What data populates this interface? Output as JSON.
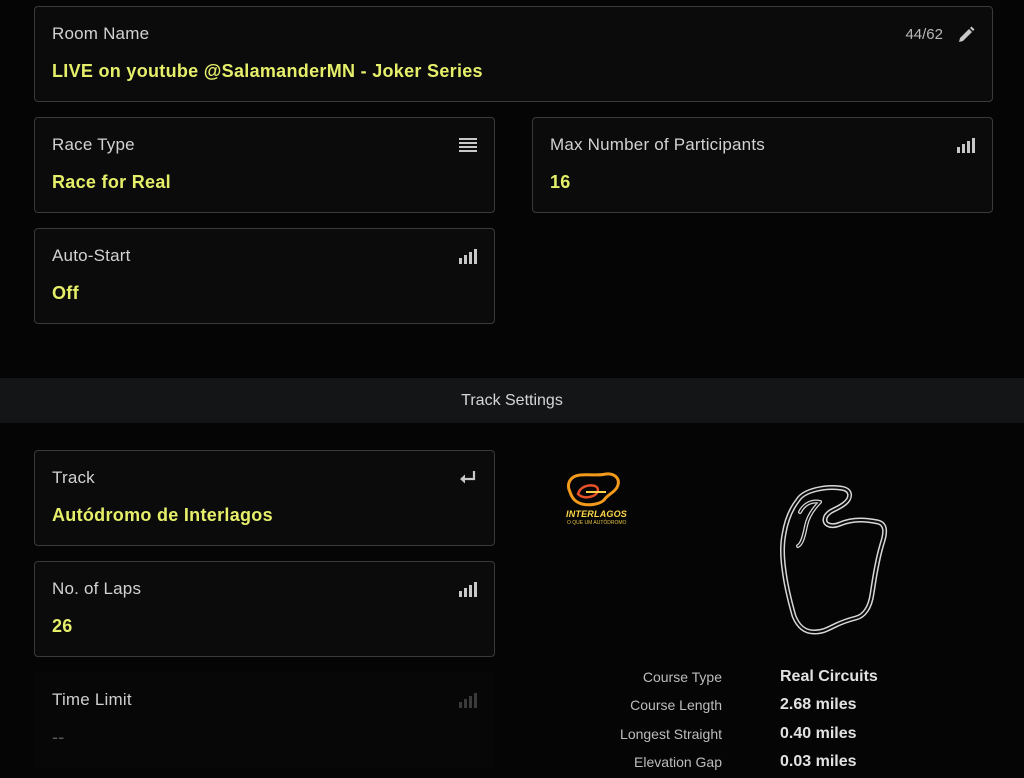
{
  "room": {
    "label": "Room Name",
    "value": "LIVE on youtube @SalamanderMN - Joker Series",
    "counter": "44/62"
  },
  "race_type": {
    "label": "Race Type",
    "value": "Race for Real"
  },
  "max_participants": {
    "label": "Max Number of Participants",
    "value": "16"
  },
  "auto_start": {
    "label": "Auto-Start",
    "value": "Off"
  },
  "section": {
    "title": "Track Settings"
  },
  "track": {
    "label": "Track",
    "value": "Autódromo de Interlagos"
  },
  "laps": {
    "label": "No. of Laps",
    "value": "26"
  },
  "time_limit": {
    "label": "Time Limit",
    "value": "--"
  },
  "logo": {
    "name": "INTERLAGOS",
    "tagline": "O QUE UM AUTÓDROMO"
  },
  "course_info": [
    {
      "key": "Course Type",
      "value": "Real Circuits"
    },
    {
      "key": "Course Length",
      "value": "2.68 miles"
    },
    {
      "key": "Longest Straight",
      "value": "0.40 miles"
    },
    {
      "key": "Elevation Gap",
      "value": "0.03 miles"
    }
  ],
  "icons": {
    "edit": "pencil-icon",
    "list": "list-icon",
    "level": "signal-bars-icon",
    "enter": "return-arrow-icon"
  },
  "colors": {
    "value_yellow": "#e6ef6a",
    "background": "#050505",
    "card_border": "#3a3a3a"
  }
}
